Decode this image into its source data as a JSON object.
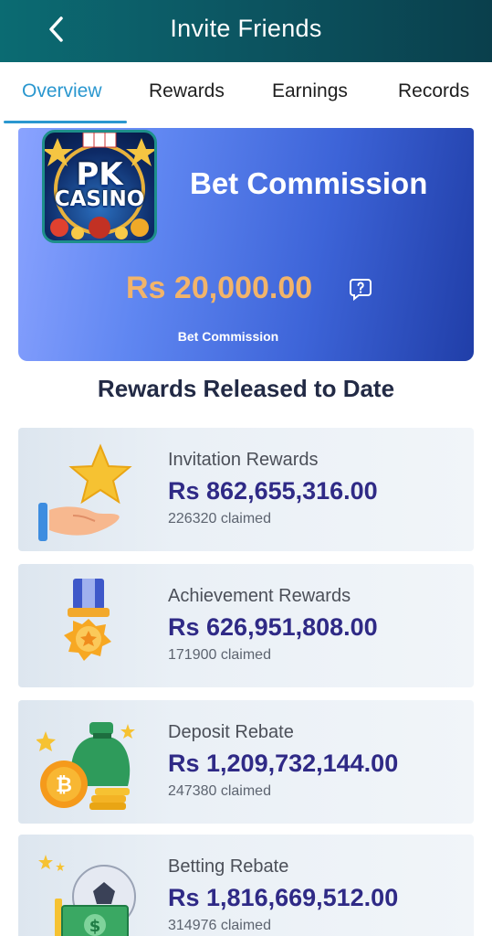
{
  "header": {
    "title": "Invite Friends"
  },
  "tabs": [
    {
      "label": "Overview",
      "active": true
    },
    {
      "label": "Rewards",
      "active": false
    },
    {
      "label": "Earnings",
      "active": false
    },
    {
      "label": "Records",
      "active": false
    }
  ],
  "banner": {
    "logo_line1": "PK",
    "logo_line2": "CASINO",
    "title": "Bet Commission",
    "amount": "Rs 20,000.00",
    "subtitle": "Bet Commission"
  },
  "section_title": "Rewards Released to Date",
  "rewards": [
    {
      "icon": "star-hand-icon",
      "title": "Invitation Rewards",
      "amount": "Rs 862,655,316.00",
      "claimed": "226320 claimed"
    },
    {
      "icon": "medal-icon",
      "title": "Achievement Rewards",
      "amount": "Rs 626,951,808.00",
      "claimed": "171900 claimed"
    },
    {
      "icon": "money-bag-coins-icon",
      "title": "Deposit Rebate",
      "amount": "Rs 1,209,732,144.00",
      "claimed": "247380 claimed"
    },
    {
      "icon": "ball-cash-icon",
      "title": "Betting Rebate",
      "amount": "Rs 1,816,669,512.00",
      "claimed": "314976 claimed"
    }
  ],
  "colors": {
    "accent": "#2a97cf",
    "amount": "#2f2a86",
    "banner_amount": "#f2b46a",
    "header": "#0b5f69"
  }
}
